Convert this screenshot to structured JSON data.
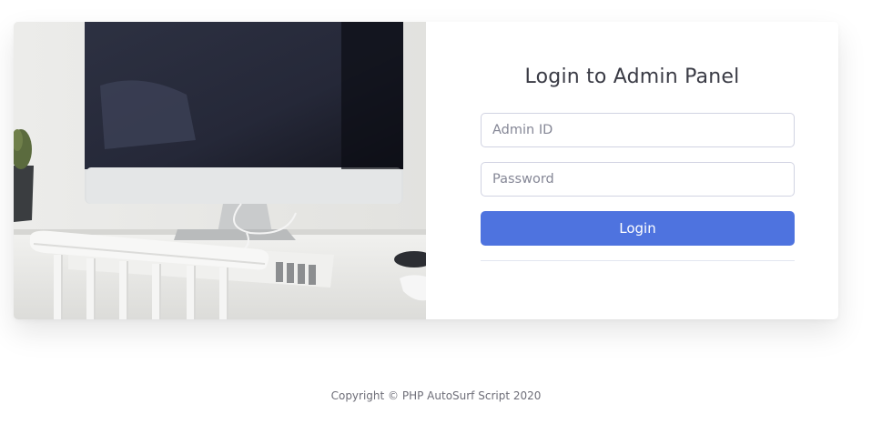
{
  "login": {
    "title": "Login to Admin Panel",
    "admin_id_placeholder": "Admin ID",
    "admin_id_value": "",
    "password_placeholder": "Password",
    "password_value": "",
    "submit_label": "Login"
  },
  "footer": {
    "text": "Copyright © PHP AutoSurf Script 2020"
  },
  "colors": {
    "accent": "#4e73df",
    "input_border": "#d1d3e2",
    "title_text": "#3a3b45"
  }
}
